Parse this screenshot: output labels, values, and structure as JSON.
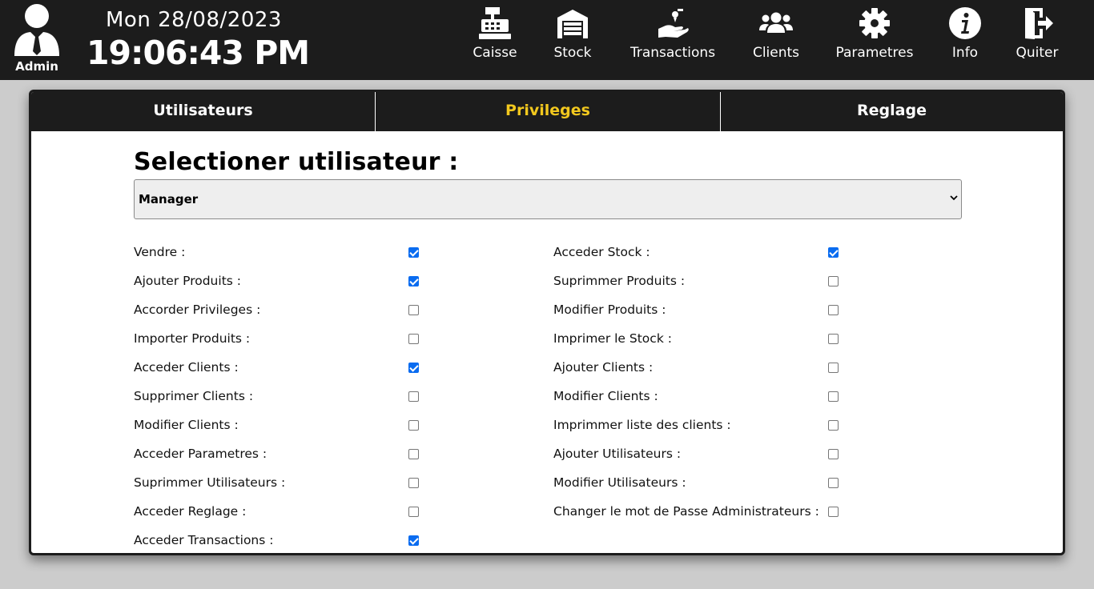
{
  "header": {
    "user_label": "Admin",
    "date": "Mon 28/08/2023",
    "time": "19:06:43 PM",
    "nav": [
      {
        "label": "Caisse",
        "icon": "cash-register-icon"
      },
      {
        "label": "Stock",
        "icon": "warehouse-icon"
      },
      {
        "label": "Transactions",
        "icon": "hand-money-icon"
      },
      {
        "label": "Clients",
        "icon": "users-icon"
      },
      {
        "label": "Parametres",
        "icon": "gear-icon"
      },
      {
        "label": "Info",
        "icon": "info-icon"
      },
      {
        "label": "Quiter",
        "icon": "door-exit-icon"
      }
    ]
  },
  "tabs": [
    {
      "label": "Utilisateurs",
      "active": false
    },
    {
      "label": "Privileges",
      "active": true
    },
    {
      "label": "Reglage",
      "active": false
    }
  ],
  "main": {
    "heading": "Selectioner utilisateur :",
    "select": {
      "value": "Manager"
    },
    "left": [
      {
        "label": "Vendre :",
        "checked": true
      },
      {
        "label": "Ajouter Produits :",
        "checked": true
      },
      {
        "label": "Accorder Privileges :",
        "checked": false
      },
      {
        "label": "Importer Produits :",
        "checked": false
      },
      {
        "label": "Acceder Clients :",
        "checked": true
      },
      {
        "label": "Supprimer Clients :",
        "checked": false
      },
      {
        "label": "Modifier Clients :",
        "checked": false
      },
      {
        "label": "Acceder Parametres :",
        "checked": false
      },
      {
        "label": "Suprimmer Utilisateurs :",
        "checked": false
      },
      {
        "label": "Acceder Reglage :",
        "checked": false
      },
      {
        "label": "Acceder Transactions :",
        "checked": true
      }
    ],
    "right": [
      {
        "label": "Acceder Stock :",
        "checked": true
      },
      {
        "label": "Suprimmer Produits :",
        "checked": false
      },
      {
        "label": "Modifier Produits :",
        "checked": false
      },
      {
        "label": "Imprimer le Stock :",
        "checked": false
      },
      {
        "label": "Ajouter Clients :",
        "checked": false
      },
      {
        "label": "Modifier Clients :",
        "checked": false
      },
      {
        "label": "Imprimmer liste des clients :",
        "checked": false
      },
      {
        "label": "Ajouter Utilisateurs :",
        "checked": false
      },
      {
        "label": "Modifier Utilisateurs :",
        "checked": false
      },
      {
        "label": "Changer le mot de Passe Administrateurs :",
        "checked": false
      }
    ]
  },
  "colors": {
    "topbar": "#1c1c1c",
    "background": "#cccccc",
    "active_tab": "#f2c81e",
    "checkbox_checked": "#0a6cf0"
  }
}
